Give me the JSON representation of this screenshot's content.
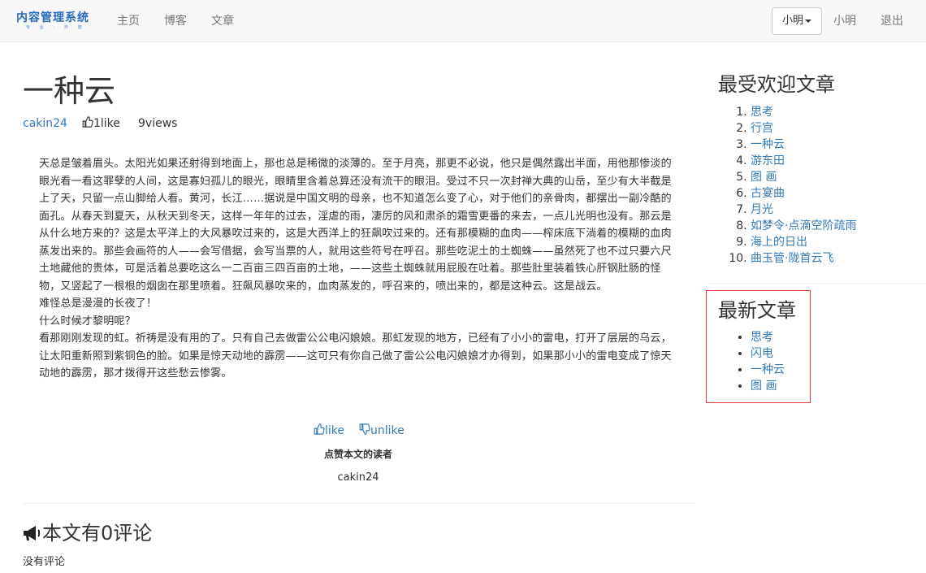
{
  "navbar": {
    "brand": "内容管理系统",
    "brand_sub": "专 业 · 开 放",
    "links": [
      "主页",
      "博客",
      "文章"
    ],
    "user_dropdown": "小明",
    "user_link": "小明",
    "logout": "退出"
  },
  "article": {
    "title": "一种云",
    "author": "cakin24",
    "likes": "1like",
    "views": "9views",
    "paragraphs": [
      "天总是皱着眉头。太阳光如果还射得到地面上，那也总是稀微的淡薄的。至于月亮，那更不必说，他只是偶然露出半面，用他那惨淡的眼光看一看这罪孽的人间，这是寡妇孤儿的眼光，眼睛里含着总算还没有流干的眼泪。受过不只一次封禅大典的山岳，至少有大半截是上了天，只留一点山脚给人看。黄河，长江……据说是中国文明的母亲，也不知道怎么变了心，对于他们的亲骨肉，都摆出一副冷酷的面孔。从春天到夏天，从秋天到冬天，这样一年年的过去，淫虐的雨，凄厉的风和肃杀的霜雪更番的来去，一点儿光明也没有。那云是从什么地方来的？这是太平洋上的大风暴吹过来的，这是大西洋上的狂飙吹过来的。还有那模糊的血肉——榨床底下淌着的模糊的血肉蒸发出来的。那些会画符的人——会写借据，会写当票的人，就用这些符号在呼召。那些吃泥土的土蜘蛛——虽然死了也不过只要六尺土地藏他的贵体，可是活着总要吃这么一二百亩三四百亩的土地，——这些土蜘蛛就用屁股在吐着。那些肚里装着铁心肝钢肚肠的怪物，又竖起了一根根的烟囱在那里喷着。狂飙风暴吹来的，血肉蒸发的，呼召来的，喷出来的，都是这种云。这是战云。",
      "难怪总是漫漫的长夜了！",
      "什么时候才黎明呢？",
      "看那刚刚发现的虹。祈祷是没有用的了。只有自己去做雷公公电闪娘娘。那虹发现的地方，已经有了小小的雷电，打开了层层的乌云，让太阳重新照到紫铜色的脸。如果是惊天动地的霹雳——这可只有你自己做了雷公公电闪娘娘才办得到，如果那小小的雷电变成了惊天动地的霹雳，那才拨得开这些愁云惨雾。"
    ],
    "like_btn": "like",
    "unlike_btn": "unlike",
    "readers_title": "点赞本文的读者",
    "readers": [
      "cakin24"
    ]
  },
  "comments": {
    "title": "本文有0评论",
    "empty": "没有评论"
  },
  "sidebar": {
    "popular_title": "最受欢迎文章",
    "popular": [
      "思考",
      "行宫",
      "一种云",
      "游东田",
      "图 画",
      "古宴曲",
      "月光",
      "如梦令·点滴空阶疏雨",
      "海上的日出",
      "曲玉管·陇首云飞"
    ],
    "latest_title": "最新文章",
    "latest": [
      "思考",
      "闪电",
      "一种云",
      "图 画"
    ]
  }
}
